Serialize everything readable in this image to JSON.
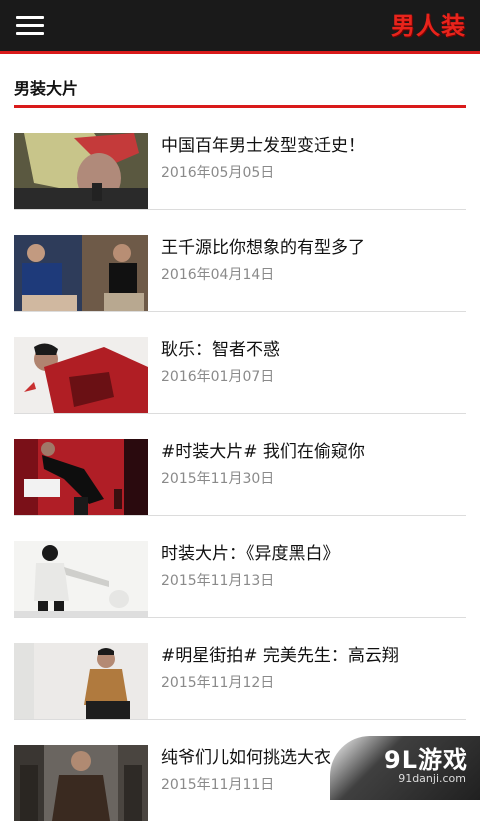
{
  "header": {
    "menu_icon": "hamburger-menu-icon",
    "logo_text": "男人装",
    "accent_color": "#d91a1a",
    "bar_color": "#1a1a1a"
  },
  "section": {
    "title": "男装大片"
  },
  "articles": [
    {
      "title": "中国百年男士发型变迁史！",
      "date": "2016年05月05日"
    },
    {
      "title": "王千源比你想象的有型多了",
      "date": "2016年04月14日"
    },
    {
      "title": "耿乐：智者不惑",
      "date": "2016年01月07日"
    },
    {
      "title": "#时装大片# 我们在偷窥你",
      "date": "2015年11月30日"
    },
    {
      "title": "时装大片：《异度黑白》",
      "date": "2015年11月13日"
    },
    {
      "title": "#明星街拍# 完美先生：高云翔",
      "date": "2015年11月12日"
    },
    {
      "title": "纯爷们儿如何挑选大衣",
      "date": "2015年11月11日"
    }
  ],
  "watermark": {
    "logo": "9L游戏",
    "url": "91danji.com"
  }
}
